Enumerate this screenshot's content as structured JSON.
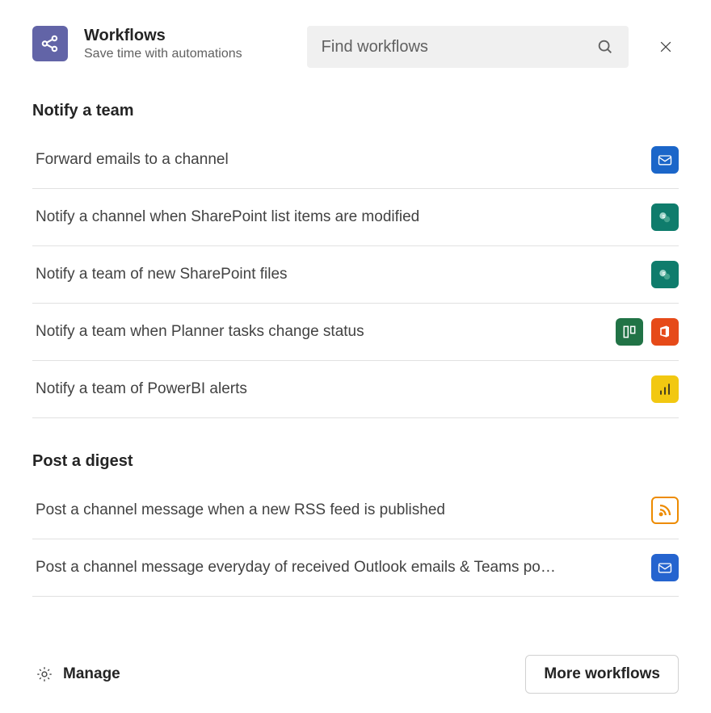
{
  "header": {
    "title": "Workflows",
    "subtitle": "Save time with automations"
  },
  "search": {
    "placeholder": "Find workflows"
  },
  "sections": [
    {
      "title": "Notify a team",
      "items": [
        {
          "label": "Forward emails to a channel",
          "icons": [
            "outlook"
          ]
        },
        {
          "label": "Notify a channel when SharePoint list items are modified",
          "icons": [
            "sharepoint"
          ]
        },
        {
          "label": "Notify a team of new SharePoint files",
          "icons": [
            "sharepoint"
          ]
        },
        {
          "label": "Notify a team when Planner tasks change status",
          "icons": [
            "planner",
            "office"
          ]
        },
        {
          "label": "Notify a team of PowerBI alerts",
          "icons": [
            "powerbi"
          ]
        }
      ]
    },
    {
      "title": "Post a digest",
      "items": [
        {
          "label": "Post a channel message when a new RSS feed is published",
          "icons": [
            "rss"
          ]
        },
        {
          "label": "Post a channel message everyday of received Outlook emails & Teams po…",
          "icons": [
            "teams-outlook"
          ]
        }
      ]
    }
  ],
  "footer": {
    "manage": "Manage",
    "more": "More workflows"
  }
}
